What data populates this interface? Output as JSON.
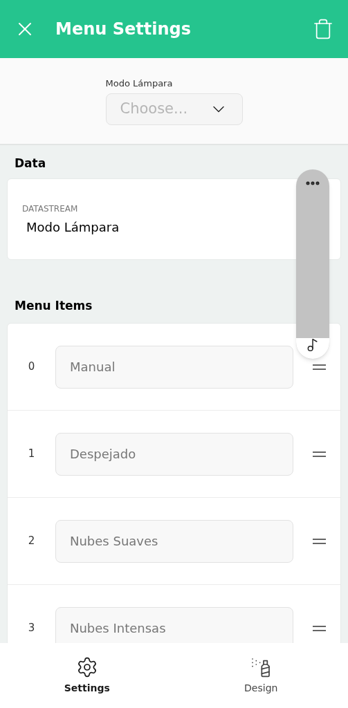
{
  "header": {
    "title": "Menu Settings"
  },
  "preview": {
    "label": "Modo Lámpara",
    "placeholder": "Choose..."
  },
  "data_section": {
    "heading": "Data",
    "field_label": "DATASTREAM",
    "field_value": "Modo Lámpara"
  },
  "menu_items": {
    "heading": "Menu Items",
    "items": [
      {
        "index": "0",
        "value": "Manual"
      },
      {
        "index": "1",
        "value": "Despejado"
      },
      {
        "index": "2",
        "value": "Nubes Suaves"
      },
      {
        "index": "3",
        "value": "Nubes Intensas"
      }
    ]
  },
  "tabs": [
    {
      "label": "Settings",
      "kind": "settings",
      "selected": true
    },
    {
      "label": "Design",
      "kind": "design",
      "selected": false
    }
  ]
}
